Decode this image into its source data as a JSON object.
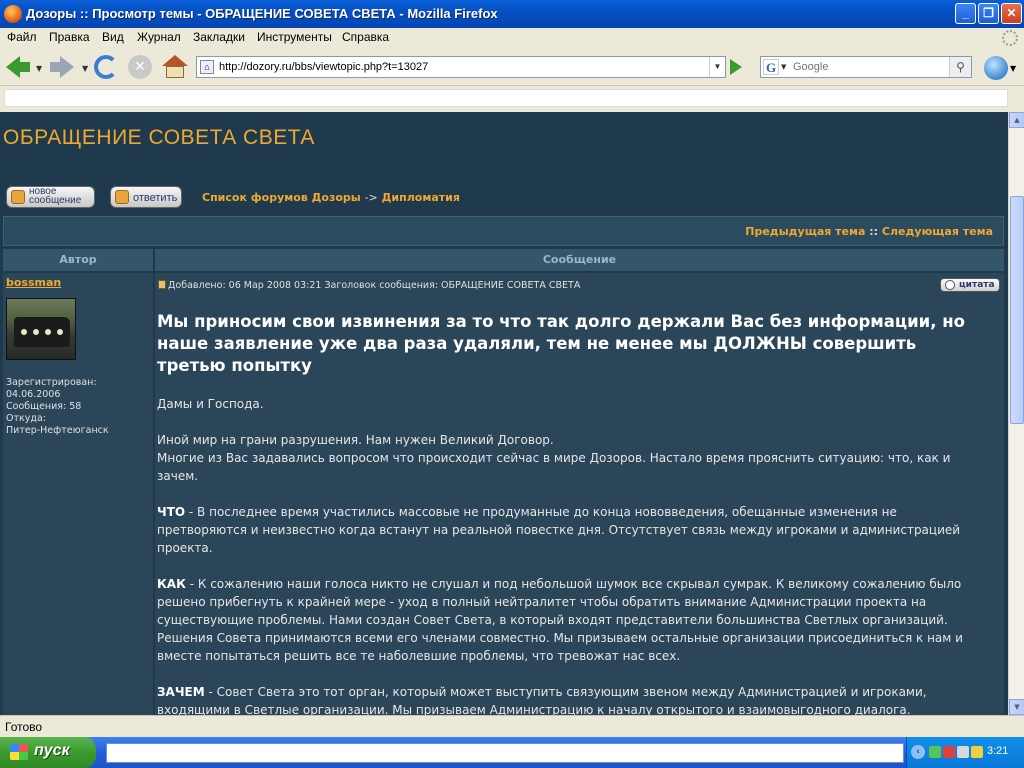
{
  "window": {
    "title": "Дозоры :: Просмотр темы - ОБРАЩЕНИЕ СОВЕТА СВЕТА - Mozilla Firefox"
  },
  "menu": [
    "Файл",
    "Правка",
    "Вид",
    "Журнал",
    "Закладки",
    "Инструменты",
    "Справка"
  ],
  "toolbar": {
    "url": "http://dozory.ru/bbs/viewtopic.php?t=13027",
    "search_placeholder": "Google"
  },
  "page": {
    "title": "ОБРАЩЕНИЕ СОВЕТА СВЕТА",
    "btn_new_line1": "новое",
    "btn_new_line2": "сообщение",
    "btn_reply": "ответить",
    "breadcrumb_forum": "Список форумов Дозоры",
    "breadcrumb_sep": "->",
    "breadcrumb_section": "Дипломатия",
    "prev_topic": "Предыдущая тема",
    "topic_sep": "::",
    "next_topic": "Следующая тема",
    "col_author": "Автор",
    "col_message": "Сообщение"
  },
  "author": {
    "name": "bossman",
    "registered_label": "Зарегистрирован:",
    "registered_date": "04.06.2006",
    "posts": "Сообщения: 58",
    "from_label": "Откуда:",
    "from_value": "Питер-Нефтеюганск"
  },
  "post": {
    "meta": "Добавлено: 06 Мар 2008 03:21    Заголовок сообщения: ОБРАЩЕНИЕ СОВЕТА СВЕТА",
    "quote_label": "цитата",
    "heading": "Мы приносим свои извинения за то что так долго держали Вас без информации, но наше заявление уже два раза удаляли, тем не менее мы ДОЛЖНЫ совершить третью попытку",
    "greeting": "Дамы и Господа.",
    "p1_line1": "Иной мир на грани разрушения. Нам нужен Великий Договор.",
    "p1_line2": "Многие из Вас задавались вопросом что происходит сейчас в мире Дозоров. Настало время прояснить ситуацию: что, как и зачем.",
    "what_label": "ЧТО",
    "what_text": " - В последнее время участились массовые не продуманные до конца нововведения, обещанные изменения не претворяются и неизвестно когда встанут на реальной повестке дня. Отсутствует связь между игроками и администрацией проекта.",
    "how_label": "КАК",
    "how_text": " - К сожалению наши голоса никто не слушал и под небольшой шумок все скрывал сумрак. К великому сожалению было решено прибегнуть к крайней мере - уход в полный нейтралитет чтобы обратить внимание Администрации проекта на существующие проблемы. Нами создан Совет Света, в который входят представители большинства Светлых организаций. Решения Совета принимаются всеми его членами совместно. Мы призываем остальные организации присоединиться к нам и вместе попытаться решить все те наболевшие проблемы, что тревожат нас всех.",
    "why_label": "ЗАЧЕМ",
    "why_text": " - Совет Света это тот орган, который может выступить связующим звеном между Администрацией и игроками, входящими в Светлые организации. Мы призываем Администрацию к началу открытого и взаимовыгодного диалога."
  },
  "status": {
    "text": "Готово"
  },
  "taskbar": {
    "start_label": "пуск",
    "clock": "3:21"
  }
}
